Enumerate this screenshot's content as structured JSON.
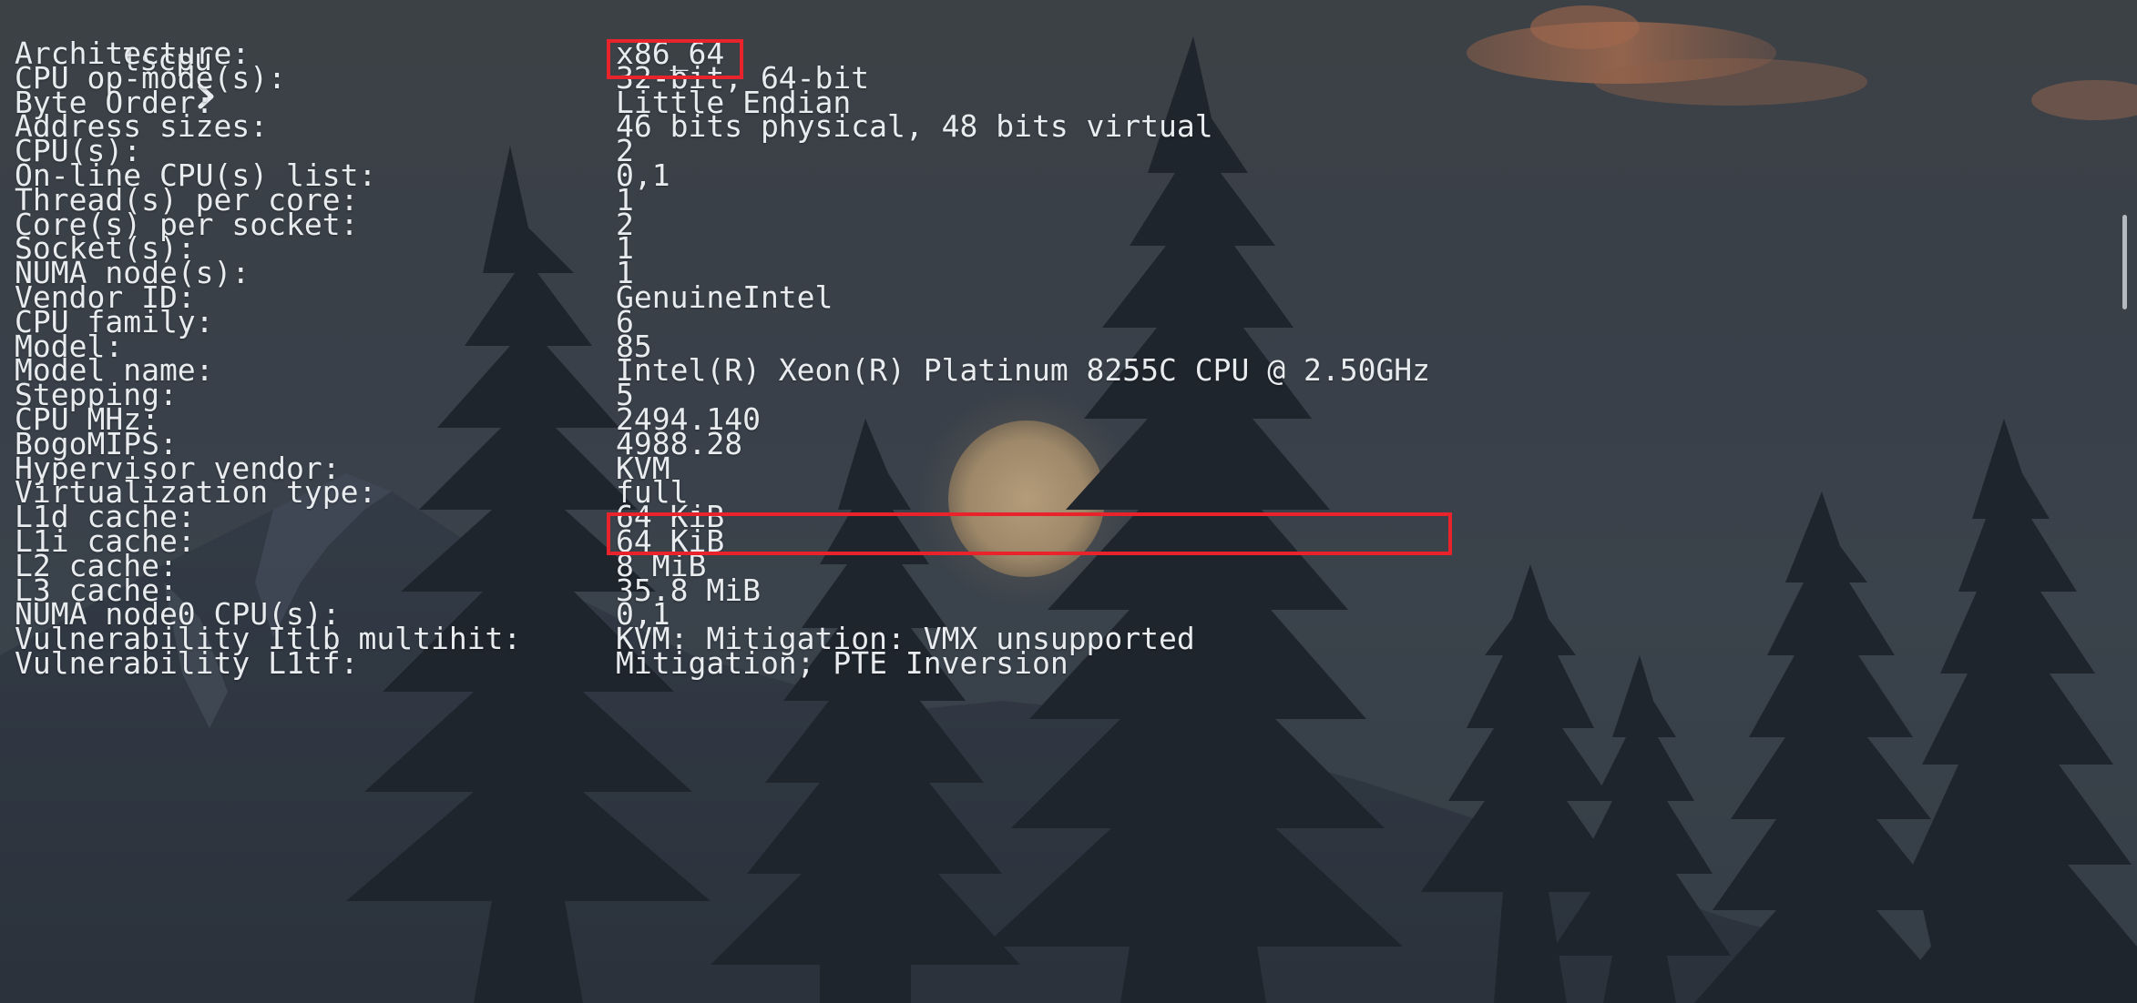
{
  "terminal": {
    "prompt": {
      "icon": "chevron-right-icon",
      "command": "lscpu"
    },
    "rows": [
      {
        "label": "Architecture:",
        "value": "x86_64"
      },
      {
        "label": "CPU op-mode(s):",
        "value": "32-bit, 64-bit"
      },
      {
        "label": "Byte Order:",
        "value": "Little Endian"
      },
      {
        "label": "Address sizes:",
        "value": "46 bits physical, 48 bits virtual"
      },
      {
        "label": "CPU(s):",
        "value": "2"
      },
      {
        "label": "On-line CPU(s) list:",
        "value": "0,1"
      },
      {
        "label": "Thread(s) per core:",
        "value": "1"
      },
      {
        "label": "Core(s) per socket:",
        "value": "2"
      },
      {
        "label": "Socket(s):",
        "value": "1"
      },
      {
        "label": "NUMA node(s):",
        "value": "1"
      },
      {
        "label": "Vendor ID:",
        "value": "GenuineIntel"
      },
      {
        "label": "CPU family:",
        "value": "6"
      },
      {
        "label": "Model:",
        "value": "85"
      },
      {
        "label": "Model name:",
        "value": "Intel(R) Xeon(R) Platinum 8255C CPU @ 2.50GHz"
      },
      {
        "label": "Stepping:",
        "value": "5"
      },
      {
        "label": "CPU MHz:",
        "value": "2494.140"
      },
      {
        "label": "BogoMIPS:",
        "value": "4988.28"
      },
      {
        "label": "Hypervisor vendor:",
        "value": "KVM"
      },
      {
        "label": "Virtualization type:",
        "value": "full"
      },
      {
        "label": "L1d cache:",
        "value": "64 KiB"
      },
      {
        "label": "L1i cache:",
        "value": "64 KiB"
      },
      {
        "label": "L2 cache:",
        "value": "8 MiB"
      },
      {
        "label": "L3 cache:",
        "value": "35.8 MiB"
      },
      {
        "label": "NUMA node0 CPU(s):",
        "value": "0,1"
      },
      {
        "label": "Vulnerability Itlb multihit:",
        "value": "KVM: Mitigation: VMX unsupported"
      },
      {
        "label": "Vulnerability L1tf:",
        "value": "Mitigation; PTE Inversion"
      }
    ]
  },
  "colors": {
    "text": "#e9ecef",
    "highlight": "#e8232b",
    "background": "#3a414a"
  }
}
